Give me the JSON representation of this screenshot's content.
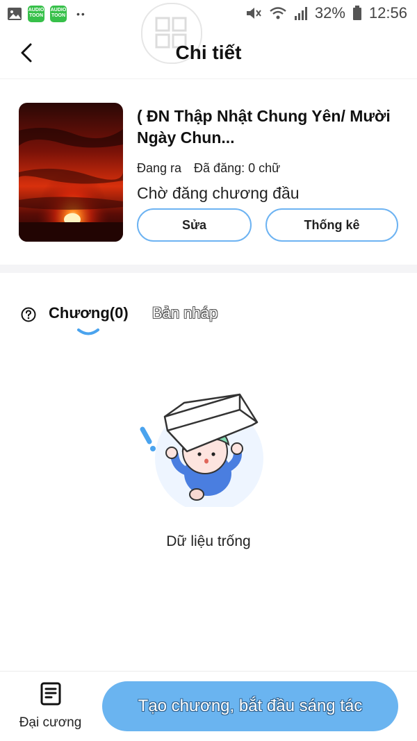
{
  "status_bar": {
    "app_icon_label_1": "AUDIO TOON",
    "app_icon_label_2": "AUDIO TOON",
    "battery": "32%",
    "time": "12:56"
  },
  "header": {
    "title": "Chi tiết"
  },
  "book": {
    "title": "( ĐN Thập Nhật Chung Yên/ Mười Ngày Chun...",
    "state": "Đang ra",
    "published": "Đã đăng: 0 chữ",
    "status": "Chờ đăng chương đầu",
    "edit_label": "Sửa",
    "stats_label": "Thống kê"
  },
  "tabs": {
    "chapters": "Chương(0)",
    "drafts": "Bản nháp"
  },
  "empty": {
    "text": "Dữ liệu trống"
  },
  "bottom": {
    "outline_label": "Đại cương",
    "create_label": "Tạo chương, bắt đầu sáng tác"
  },
  "colors": {
    "accent": "#6ab4f0",
    "outline_border": "#6db3f2"
  }
}
